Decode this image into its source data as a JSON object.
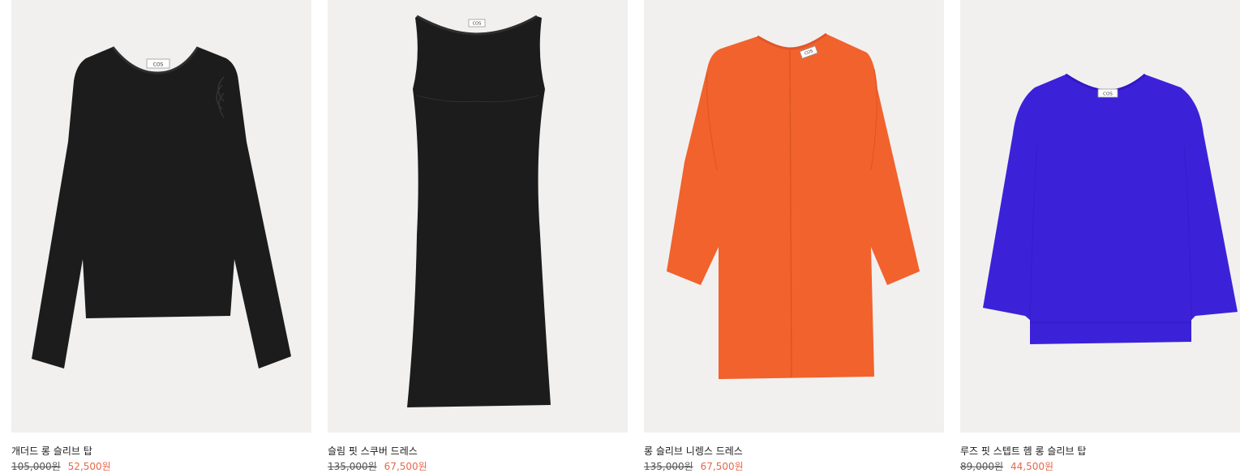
{
  "products": [
    {
      "name": "개더드 롱 슬리브 탑",
      "original_price": "105,000원",
      "sale_price": "52,500원",
      "color": "#1c1c1c",
      "brand_label": "COS"
    },
    {
      "name": "슬림 핏 스쿠버 드레스",
      "original_price": "135,000원",
      "sale_price": "67,500원",
      "color": "#1c1c1c",
      "brand_label": "COS"
    },
    {
      "name": "롱 슬리브 니렝스 드레스",
      "original_price": "135,000원",
      "sale_price": "67,500원",
      "color": "#f1622d",
      "brand_label": "COS"
    },
    {
      "name": "루즈 핏 스텝트 헴 롱 슬리브 탑",
      "original_price": "89,000원",
      "sale_price": "44,500원",
      "color": "#3b22d9",
      "brand_label": "COS"
    }
  ],
  "colors": {
    "image_background": "#f1f0ef",
    "sale_price": "#e7674a",
    "text": "#1a1a1a"
  }
}
